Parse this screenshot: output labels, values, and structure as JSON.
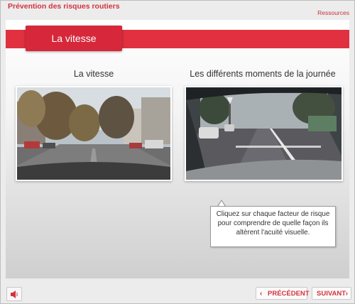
{
  "app": {
    "title": "Prévention des risques routiers",
    "resources_link": "Ressources"
  },
  "banner": {
    "title": "La vitesse"
  },
  "cards": [
    {
      "title": "La vitesse",
      "image": "urban-street-photo"
    },
    {
      "title": "Les différents moments de la journée",
      "image": "dashboard-road-photo"
    }
  ],
  "tooltip": {
    "text": "Cliquez sur chaque facteur de risque pour comprendre de quelle façon ils altèrent l'acuité visuelle."
  },
  "footer": {
    "sound_icon": "speaker-icon",
    "prev_label": "PRÉCÉDENT",
    "next_label": "SUIVANT"
  },
  "colors": {
    "accent": "#e1303f",
    "text_red": "#d4323d"
  }
}
